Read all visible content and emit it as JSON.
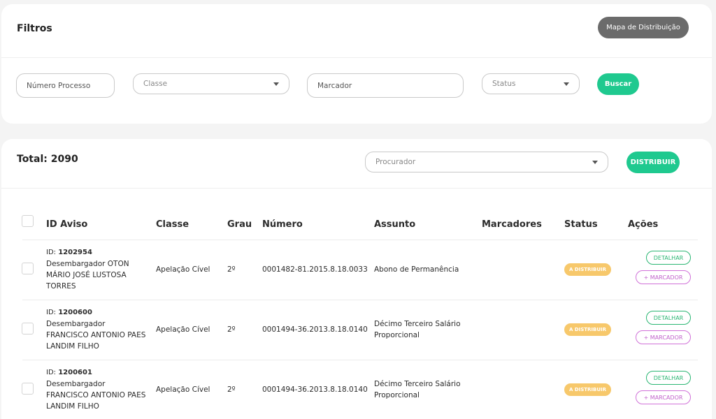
{
  "filters": {
    "title": "Filtros",
    "map_button": "Mapa de Distribuição",
    "process_number_placeholder": "Número Processo",
    "class_select": "Classe",
    "marker_placeholder": "Marcador",
    "status_select": "Status",
    "search_button": "Buscar"
  },
  "results": {
    "total_label": "Total: 2090",
    "prosecutor_select": "Procurador",
    "distribute_button": "DISTRIBUIR",
    "columns": [
      "ID Aviso",
      "Classe",
      "Grau",
      "Número",
      "Assunto",
      "Marcadores",
      "Status",
      "Ações"
    ],
    "rows": [
      {
        "id_prefix": "ID: ",
        "id": "1202954",
        "name_lines": [
          "Desembargador OTON",
          "MÁRIO JOSÉ LUSTOSA",
          "TORRES"
        ],
        "classe": "Apelação Cível",
        "grau": "2º",
        "numero": "0001482-81.2015.8.18.0033",
        "assunto_lines": [
          "Abono de Permanência"
        ],
        "marcadores": "",
        "status": "A DISTRIBUIR",
        "detail_label": "DETALHAR",
        "marker_label": "+ MARCADOR"
      },
      {
        "id_prefix": "ID: ",
        "id": "1200600",
        "name_lines": [
          "Desembargador",
          "FRANCISCO ANTONIO PAES",
          "LANDIM FILHO"
        ],
        "classe": "Apelação Cível",
        "grau": "2º",
        "numero": "0001494-36.2013.8.18.0140",
        "assunto_lines": [
          "Décimo Terceiro Salário",
          "Proporcional"
        ],
        "marcadores": "",
        "status": "A DISTRIBUIR",
        "detail_label": "DETALHAR",
        "marker_label": "+ MARCADOR"
      },
      {
        "id_prefix": "ID: ",
        "id": "1200601",
        "name_lines": [
          "Desembargador",
          "FRANCISCO ANTONIO PAES",
          "LANDIM FILHO"
        ],
        "classe": "Apelação Cível",
        "grau": "2º",
        "numero": "0001494-36.2013.8.18.0140",
        "assunto_lines": [
          "Décimo Terceiro Salário",
          "Proporcional"
        ],
        "marcadores": "",
        "status": "A DISTRIBUIR",
        "detail_label": "DETALHAR",
        "marker_label": "+ MARCADOR"
      }
    ]
  },
  "colors": {
    "accent_green": "#1fc98f",
    "status_badge": "#f7c86b",
    "marker_pink": "#d071d8",
    "dark_button": "#6b6b6b"
  }
}
